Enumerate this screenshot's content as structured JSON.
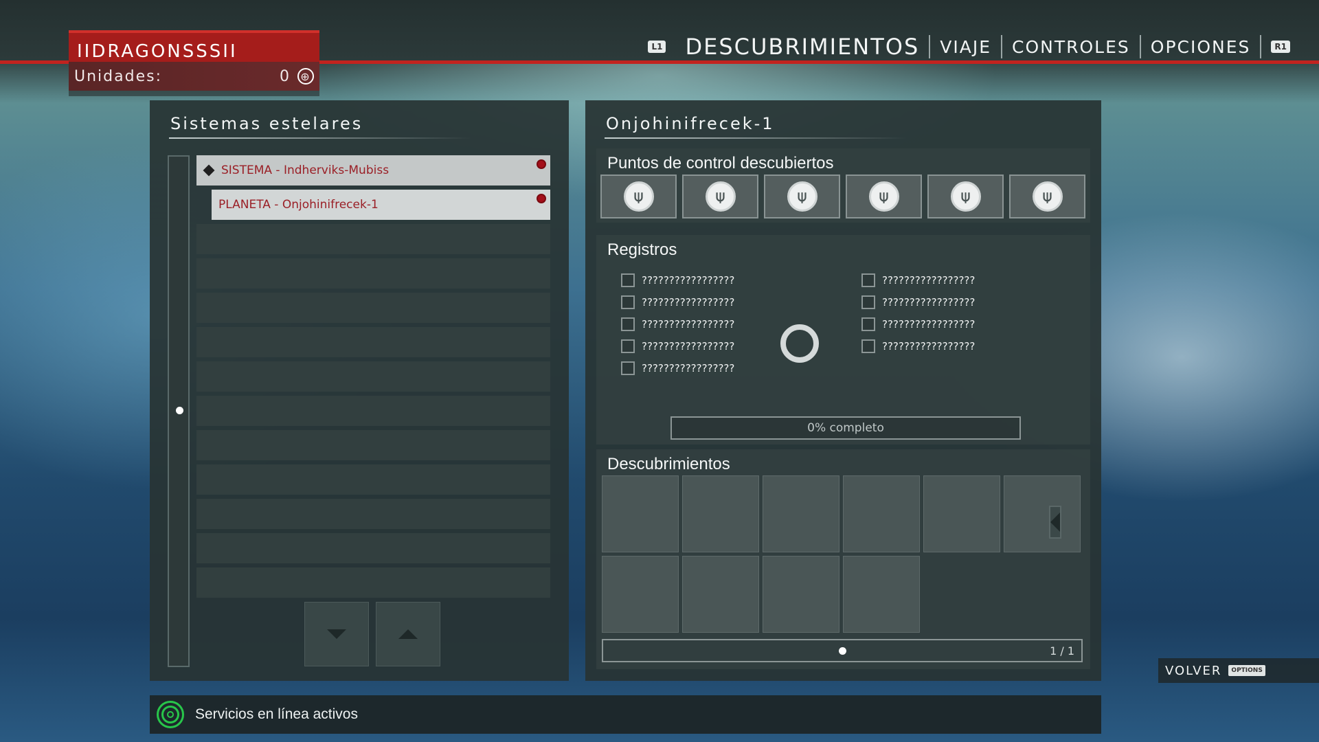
{
  "profile": {
    "name": "IIDRAGONSSSII",
    "units_label": "Unidades:",
    "units_value": "0",
    "currency_icon": "units-currency-icon"
  },
  "nav": {
    "left_key": "L1",
    "tabs": [
      {
        "label": "DESCUBRIMIENTOS",
        "active": true
      },
      {
        "label": "VIAJE",
        "active": false
      },
      {
        "label": "CONTROLES",
        "active": false
      },
      {
        "label": "OPCIONES",
        "active": false
      }
    ],
    "right_key": "R1"
  },
  "left_panel": {
    "title": "Sistemas estelares",
    "items": [
      {
        "label": "SISTEMA - Indherviks-Mubiss",
        "marker": "diamond-icon",
        "flag": "red-dot"
      },
      {
        "label": "PLANETA - Onjohinifrecek-1",
        "flag": "red-dot"
      }
    ],
    "empty_rows": 11
  },
  "right_panel": {
    "title": "Onjohinifrecek-1",
    "checkpoints": {
      "title": "Puntos de control descubiertos",
      "count": 6,
      "icon": "checkpoint-icon"
    },
    "records": {
      "title": "Registros",
      "col1": [
        "?????????????????",
        "?????????????????",
        "?????????????????",
        "?????????????????",
        "?????????????????"
      ],
      "col2": [
        "?????????????????",
        "?????????????????",
        "?????????????????",
        "?????????????????"
      ],
      "progress_text": "0% completo",
      "progress_fraction": 0
    },
    "discoveries": {
      "title": "Descubrimientos",
      "page": "1 / 1"
    }
  },
  "volver": {
    "label": "VOLVER",
    "key": "OPTIONS"
  },
  "status": {
    "text": "Servicios en línea activos"
  },
  "colors": {
    "accent_red": "#c2231f",
    "online_green": "#28c64a"
  }
}
